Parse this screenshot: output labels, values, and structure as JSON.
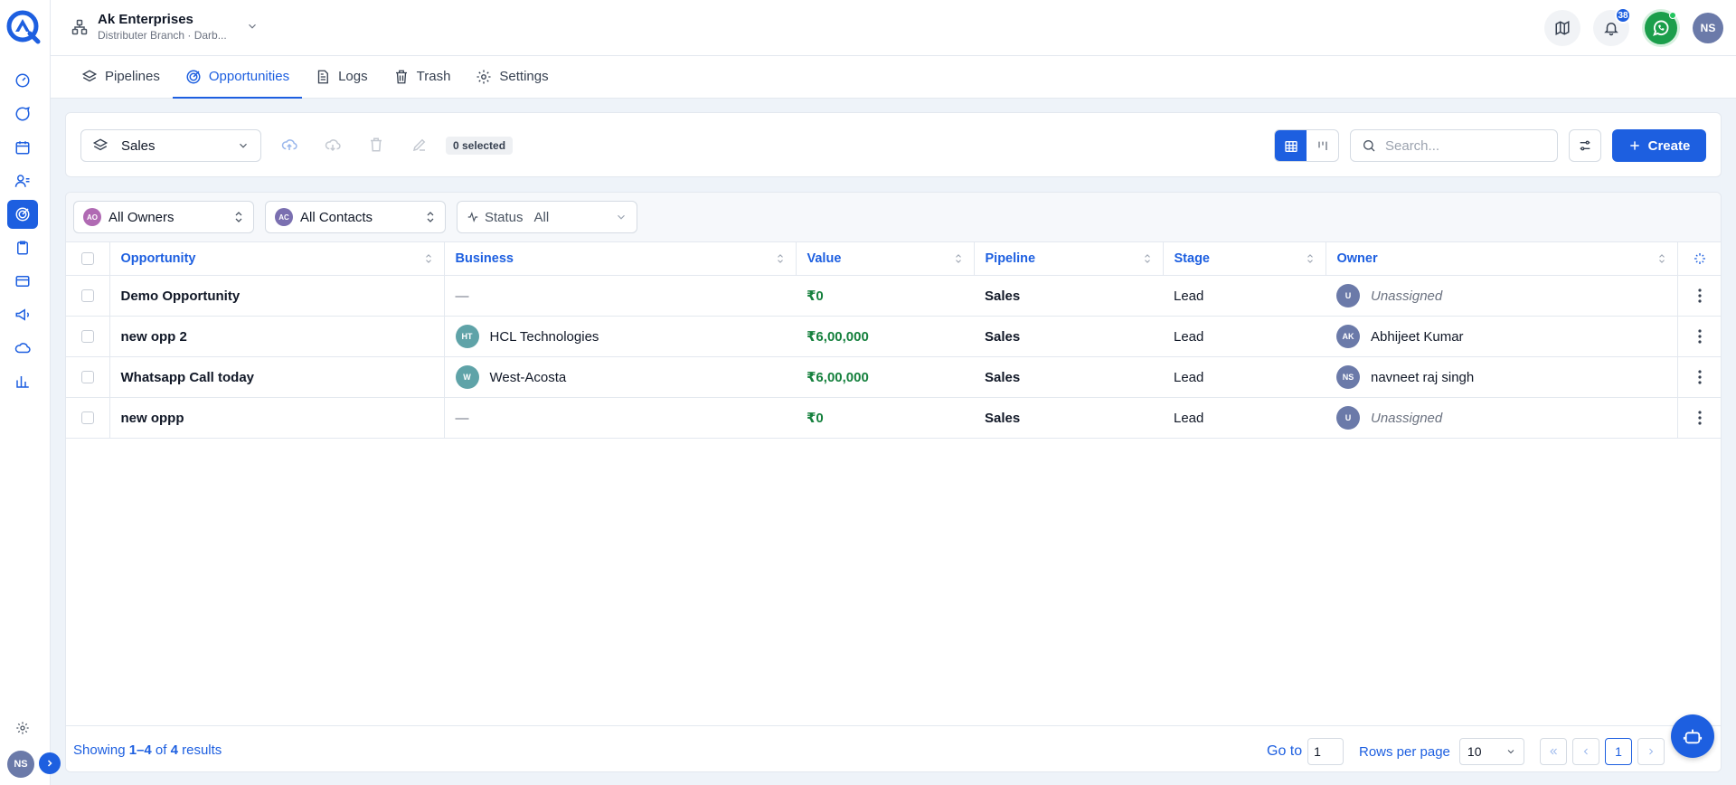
{
  "org": {
    "name": "Ak Enterprises",
    "branch": "Distributer Branch · Darb..."
  },
  "notifications": {
    "count": "38"
  },
  "user": {
    "initials": "NS"
  },
  "tabs": [
    {
      "label": "Pipelines",
      "icon": "layers-icon"
    },
    {
      "label": "Opportunities",
      "icon": "target-icon",
      "active": true
    },
    {
      "label": "Logs",
      "icon": "document-icon"
    },
    {
      "label": "Trash",
      "icon": "trash-icon"
    },
    {
      "label": "Settings",
      "icon": "gear-icon"
    }
  ],
  "toolbar": {
    "pipeline": "Sales",
    "selected": "0 selected",
    "search_placeholder": "Search...",
    "create_label": "Create"
  },
  "filters": {
    "owners": {
      "initials": "AO",
      "label": "All Owners"
    },
    "contacts": {
      "initials": "AC",
      "label": "All Contacts"
    },
    "status": {
      "label": "Status",
      "value": "All"
    }
  },
  "table": {
    "columns": [
      "Opportunity",
      "Business",
      "Value",
      "Pipeline",
      "Stage",
      "Owner"
    ],
    "rows": [
      {
        "opportunity": "Demo Opportunity",
        "business": "—",
        "business_initials": "",
        "value": "₹0",
        "pipeline": "Sales",
        "stage": "Lead",
        "owner": "Unassigned",
        "owner_initials": "U"
      },
      {
        "opportunity": "new opp 2",
        "business": "HCL Technologies",
        "business_initials": "HT",
        "value": "₹6,00,000",
        "pipeline": "Sales",
        "stage": "Lead",
        "owner": "Abhijeet Kumar",
        "owner_initials": "AK"
      },
      {
        "opportunity": "Whatsapp Call today",
        "business": "West-Acosta",
        "business_initials": "W",
        "value": "₹6,00,000",
        "pipeline": "Sales",
        "stage": "Lead",
        "owner": "navneet raj singh",
        "owner_initials": "NS"
      },
      {
        "opportunity": "new oppp",
        "business": "—",
        "business_initials": "",
        "value": "₹0",
        "pipeline": "Sales",
        "stage": "Lead",
        "owner": "Unassigned",
        "owner_initials": "U"
      }
    ]
  },
  "footer": {
    "showing_prefix": "Showing",
    "range": "1–4",
    "of": "of",
    "total": "4",
    "suffix": "results",
    "goto_label": "Go to",
    "goto_value": "1",
    "rows_label": "Rows per page",
    "rows_value": "10",
    "current_page": "1"
  },
  "colors": {
    "primary": "#1d5fe0",
    "value_green": "#15803d",
    "whatsapp": "#1b9e4b"
  }
}
